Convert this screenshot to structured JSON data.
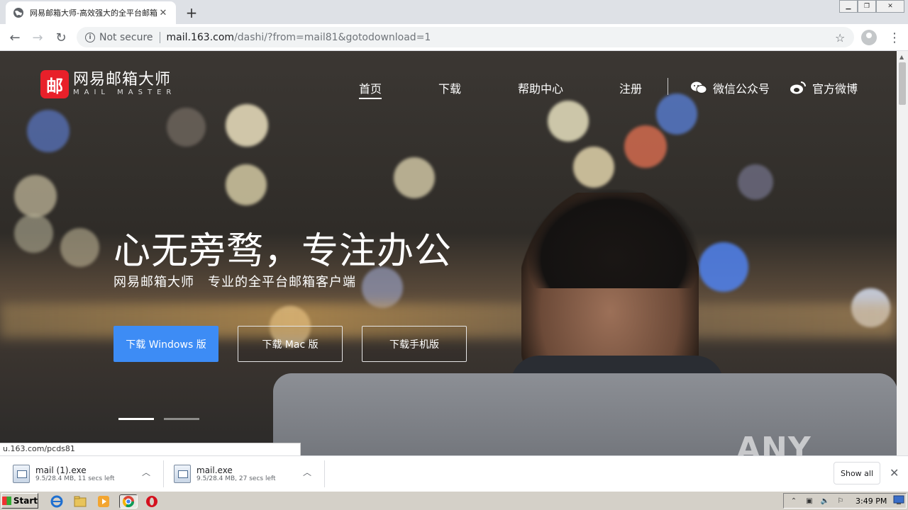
{
  "browser": {
    "tab_title": "网易邮箱大师-高效强大的全平台邮箱",
    "new_tab_symbol": "+",
    "security_label": "Not secure",
    "url_host": "mail.163.com",
    "url_path": "/dashi/?from=mail81&gotodownload=1"
  },
  "site": {
    "logo_mark": "邮",
    "logo_cn": "网易邮箱大师",
    "logo_en": "MAIL MASTER",
    "nav": [
      "首页",
      "下载",
      "帮助中心",
      "注册"
    ],
    "social": [
      "微信公众号",
      "官方微博"
    ],
    "headline": "心无旁骛，专注办公",
    "subline": "网易邮箱大师　专业的全平台邮箱客户端",
    "buttons": {
      "windows": "下载 Windows 版",
      "mac": "下载 Mac 版",
      "mobile": "下载手机版"
    },
    "carousel_active": 1,
    "carousel_count": 2
  },
  "status_bar_url": "u.163.com/pcds81",
  "watermark": "ANY RUN",
  "downloads": [
    {
      "name": "mail (1).exe",
      "status": "9.5/28.4 MB, 11 secs left"
    },
    {
      "name": "mail.exe",
      "status": "9.5/28.4 MB, 27 secs left"
    }
  ],
  "shelf": {
    "show_all": "Show all"
  },
  "taskbar": {
    "start_label": "Start",
    "clock": "3:49 PM"
  },
  "colors": {
    "accent": "#3d8cf5",
    "logo_red": "#e8202a"
  }
}
